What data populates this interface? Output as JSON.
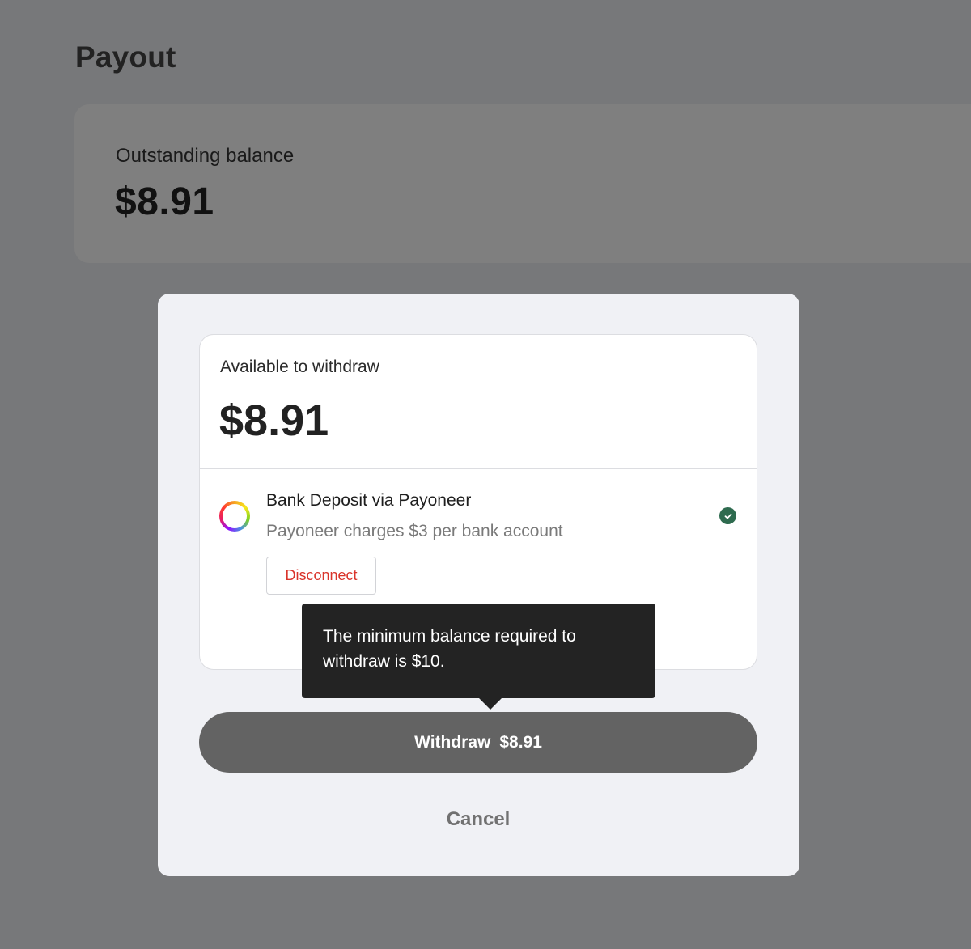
{
  "page": {
    "title": "Payout"
  },
  "balance_card": {
    "label": "Outstanding balance",
    "amount": "$8.91"
  },
  "withdraw_modal": {
    "available_label": "Available to withdraw",
    "available_amount": "$8.91",
    "payout_method": {
      "title": "Bank Deposit via Payoneer",
      "subtitle": "Payoneer charges $3 per bank account",
      "icon": "payoneer-ring-icon",
      "status_icon": "check-circle-icon",
      "status_color": "#2e6b4f",
      "disconnect_label": "Disconnect"
    },
    "tooltip": {
      "text": "The minimum balance required to withdraw is $10."
    },
    "withdraw_button": {
      "label": "Withdraw",
      "amount": "$8.91"
    },
    "cancel_label": "Cancel"
  },
  "colors": {
    "backdrop": "#77787a",
    "modal_background": "#f0f1f5",
    "disconnect_text": "#d9342b",
    "withdraw_button_disabled": "#636363",
    "tooltip_background": "#232323"
  }
}
